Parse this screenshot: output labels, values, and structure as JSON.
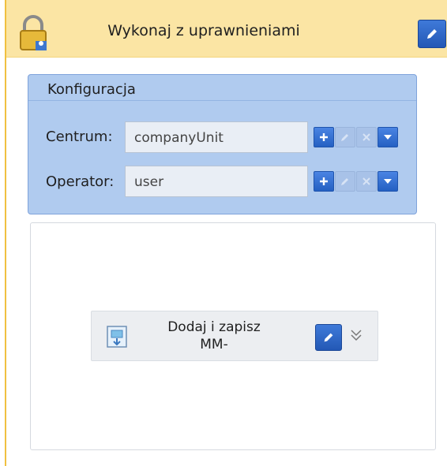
{
  "header": {
    "title": "Wykonaj z uprawnieniami"
  },
  "config": {
    "title": "Konfiguracja",
    "rows": [
      {
        "label": "Centrum:",
        "value": "companyUnit"
      },
      {
        "label": "Operator:",
        "value": "user"
      }
    ]
  },
  "action": {
    "label_line1": "Dodaj i zapisz",
    "label_line2": "MM-"
  },
  "colors": {
    "header_bg": "#fbe5a4",
    "panel_bg": "#b0cbef",
    "accent_blue": "#2f6bcf"
  },
  "icons": {
    "header": "lock-icon",
    "edit": "pencil-icon",
    "add": "plus-icon",
    "edit_item": "pencil-icon",
    "delete": "x-icon",
    "dropdown": "triangle-down-icon",
    "action": "document-icon",
    "expand": "double-chevron-down-icon"
  }
}
